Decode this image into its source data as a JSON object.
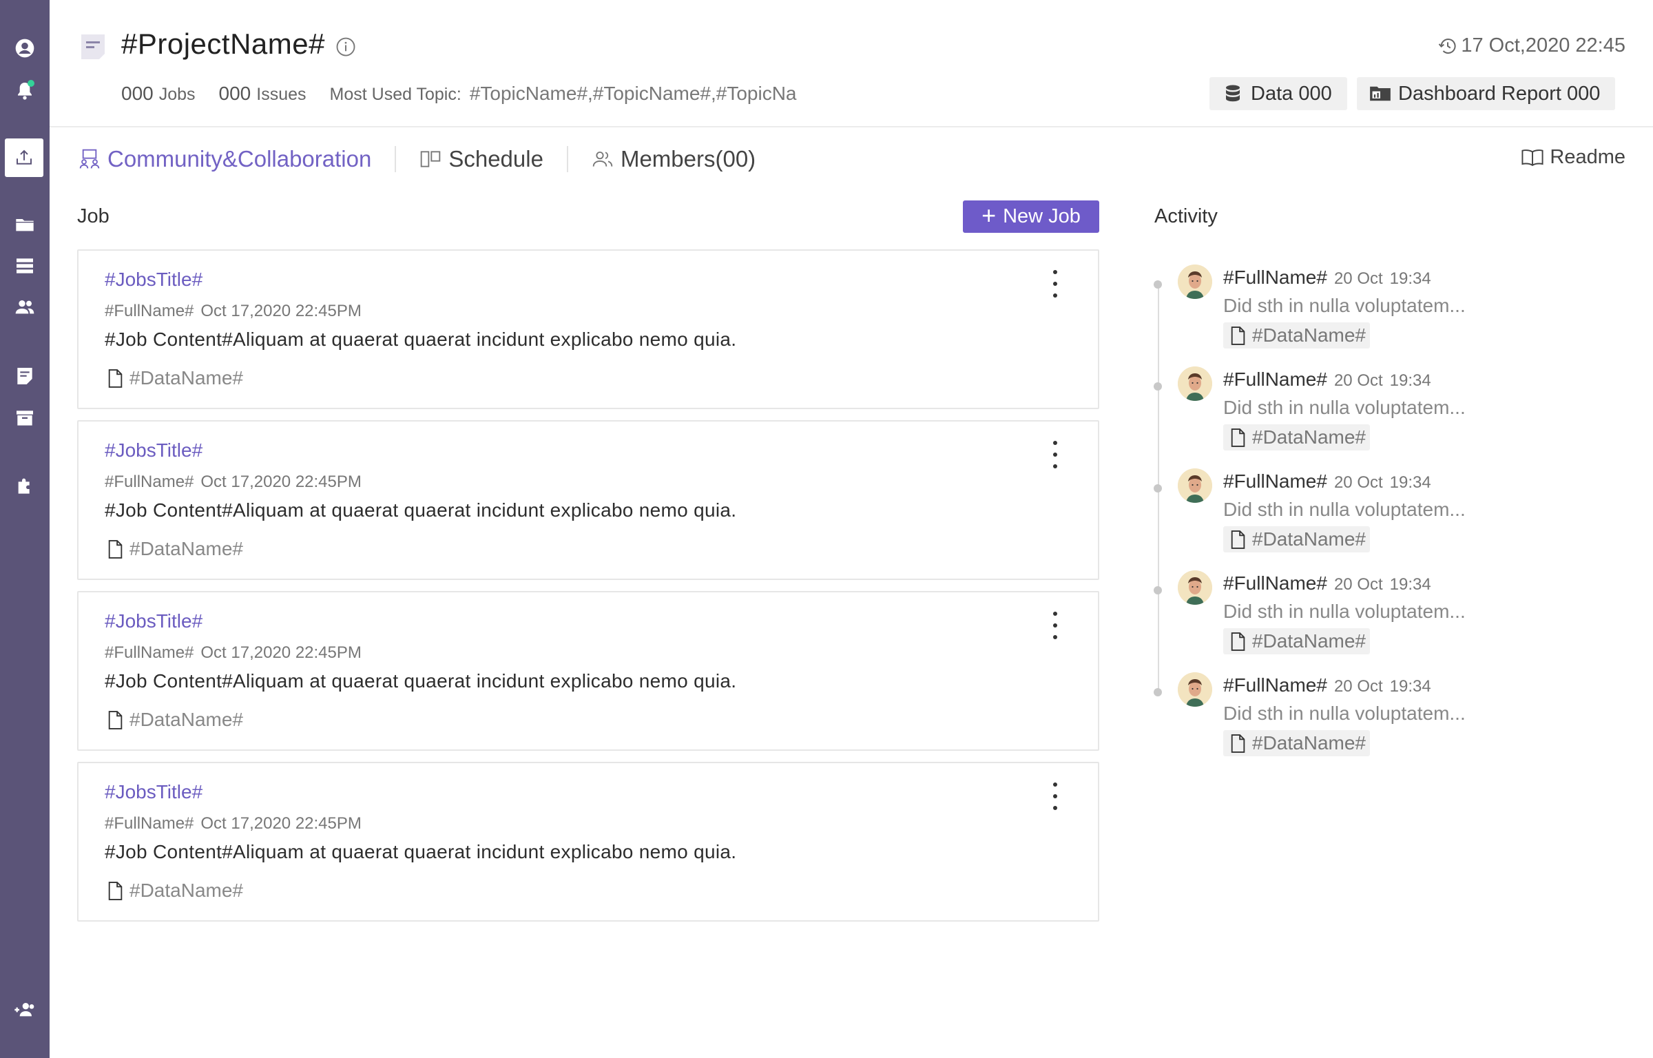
{
  "sidebar": {
    "icons": [
      "account-icon",
      "bell-icon",
      "upload-icon",
      "folder-icon",
      "database-icon",
      "users-icon",
      "document-icon",
      "archive-icon",
      "puzzle-icon",
      "add-user-icon"
    ],
    "notification_color": "#34d399",
    "background": "#5b5478"
  },
  "header": {
    "project_name": "#ProjectName#",
    "timestamp": "17 Oct,2020 22:45",
    "jobs_count": "000",
    "jobs_label": "Jobs",
    "issues_count": "000",
    "issues_label": "Issues",
    "topic_label": "Most Used Topic:",
    "topics": "#TopicName#,#TopicName#,#TopicNa",
    "data_button": "Data 000",
    "dashboard_button": "Dashboard Report 000"
  },
  "tabs": [
    {
      "label": "Community&Collaboration",
      "active": true
    },
    {
      "label": "Schedule",
      "active": false
    },
    {
      "label": "Members(00)",
      "active": false
    }
  ],
  "readme_label": "Readme",
  "job_section": {
    "heading": "Job",
    "new_job_label": "New Job",
    "jobs": [
      {
        "title": "#JobsTitle#",
        "author": "#FullName#",
        "date": "Oct 17,2020 22:45PM",
        "content": "#Job Content#Aliquam at quaerat quaerat incidunt explicabo nemo quia.",
        "data": "#DataName#"
      },
      {
        "title": "#JobsTitle#",
        "author": "#FullName#",
        "date": "Oct 17,2020 22:45PM",
        "content": "#Job Content#Aliquam at quaerat quaerat incidunt explicabo nemo quia.",
        "data": "#DataName#"
      },
      {
        "title": "#JobsTitle#",
        "author": "#FullName#",
        "date": "Oct 17,2020 22:45PM",
        "content": "#Job Content#Aliquam at quaerat quaerat incidunt explicabo nemo quia.",
        "data": "#DataName#"
      },
      {
        "title": "#JobsTitle#",
        "author": "#FullName#",
        "date": "Oct 17,2020 22:45PM",
        "content": "#Job Content#Aliquam at quaerat quaerat incidunt explicabo nemo quia.",
        "data": "#DataName#"
      }
    ]
  },
  "activity": {
    "heading": "Activity",
    "items": [
      {
        "name": "#FullName#",
        "date": "20 Oct",
        "time": "19:34",
        "desc": "Did sth in nulla voluptatem...",
        "data": "#DataName#"
      },
      {
        "name": "#FullName#",
        "date": "20 Oct",
        "time": "19:34",
        "desc": "Did sth in nulla voluptatem...",
        "data": "#DataName#"
      },
      {
        "name": "#FullName#",
        "date": "20 Oct",
        "time": "19:34",
        "desc": "Did sth in nulla voluptatem...",
        "data": "#DataName#"
      },
      {
        "name": "#FullName#",
        "date": "20 Oct",
        "time": "19:34",
        "desc": "Did sth in nulla voluptatem...",
        "data": "#DataName#"
      },
      {
        "name": "#FullName#",
        "date": "20 Oct",
        "time": "19:34",
        "desc": "Did sth in nulla voluptatem...",
        "data": "#DataName#"
      }
    ]
  },
  "colors": {
    "accent": "#6e5bc9",
    "link": "#6b5cc0"
  }
}
